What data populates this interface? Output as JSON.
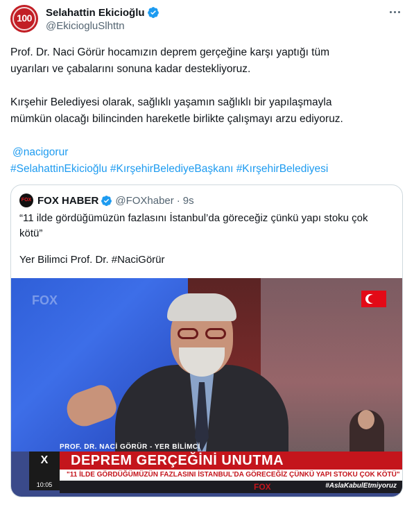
{
  "author": {
    "avatar_text": "100",
    "name": "Selahattin Ekicioğlu",
    "handle": "@EkiciogluSlhttn"
  },
  "tweet": {
    "paragraph1": [
      "Prof. Dr. Naci Görür hocamızın deprem gerçeğine karşı yaptığı tüm",
      "uyarıları ve çabalarını sonuna kadar destekliyoruz."
    ],
    "paragraph2": [
      "Kırşehir Belediyesi olarak, sağlıklı yaşamın sağlıklı bir yapılaşmayla",
      "mümkün olacağı bilincinden hareketle birlikte çalışmayı arzu ediyoruz."
    ],
    "mention": "@nacigorur",
    "hashtags": "#SelahattinEkicioğlu #KırşehirBelediyeBaşkanı #KırşehirBelediyesi"
  },
  "quote": {
    "avatar_text": "FOX",
    "name": "FOX HABER",
    "handle": "@FOXhaber",
    "time": "9s",
    "text_line1": "“11 ilde gördüğümüzün fazlasını İstanbul’da göreceğiz çünkü yapı stoku çok",
    "text_line2": "kötü”",
    "text_line3": "Yer Bilimci Prof. Dr. #NaciGörür"
  },
  "media": {
    "watermark": "FOX",
    "lower_label": "PROF. DR. NACİ GÖRÜR - YER BİLİMCİ",
    "x_logo": "X",
    "time": "10:05",
    "headline": "DEPREM GERÇEĞİNİ UNUTMA",
    "subline": "\"11 İLDE GÖRDÜĞÜMÜZÜN FAZLASINI İSTANBUL'DA GÖRECEĞİZ ÇÜNKÜ YAPI STOKU ÇOK KÖTÜ\"",
    "tag": "#AslaKabulEtmiyoruz",
    "bottom_logo": "FOX"
  },
  "colors": {
    "link": "#1d9bf0",
    "verified": "#1d9bf0",
    "headline_red": "#c4151c"
  }
}
